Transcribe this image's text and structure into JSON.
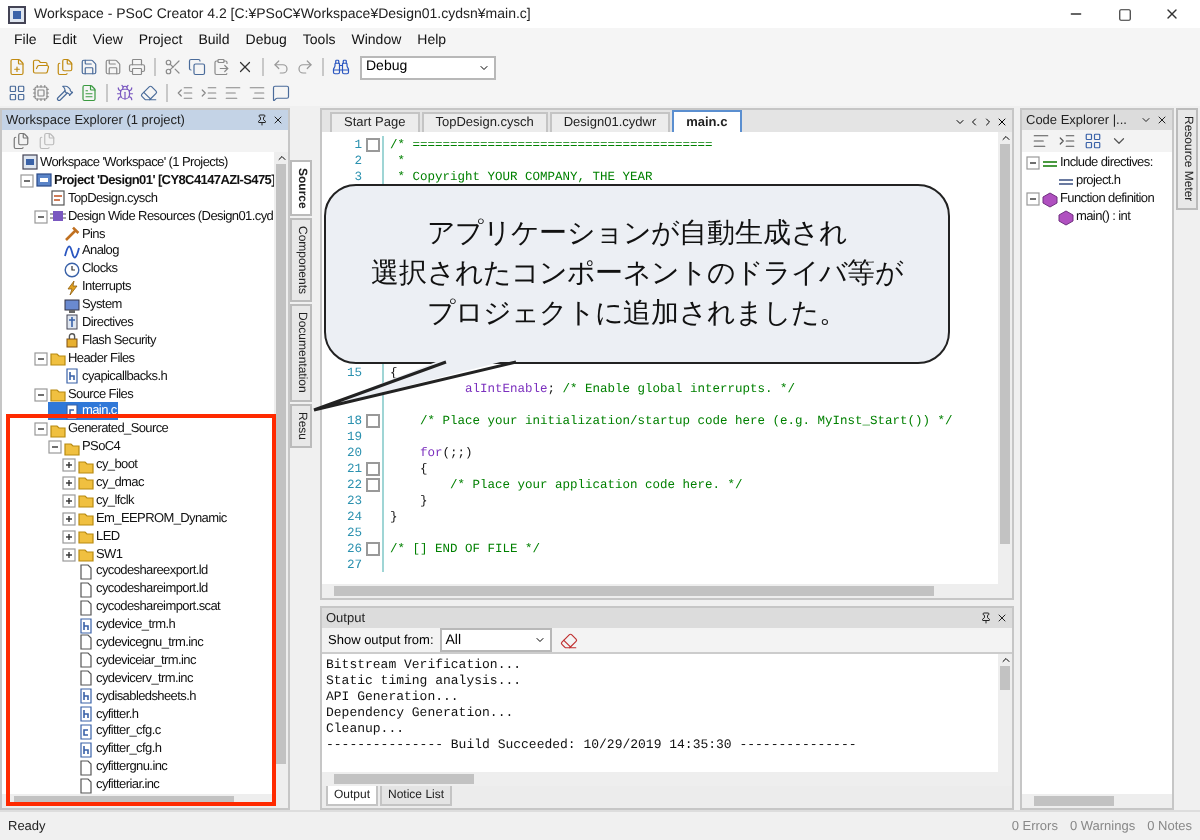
{
  "window": {
    "title": "Workspace - PSoC Creator 4.2  [C:¥PSoC¥Workspace¥Design01.cydsn¥main.c]"
  },
  "menu": [
    "File",
    "Edit",
    "View",
    "Project",
    "Build",
    "Debug",
    "Tools",
    "Window",
    "Help"
  ],
  "toolbar": {
    "configuration": "Debug"
  },
  "workspace_explorer": {
    "title": "Workspace Explorer (1 project)",
    "tree": [
      {
        "label": "Workspace 'Workspace' (1 Projects)",
        "kind": "workspace",
        "selected": false,
        "children": [
          {
            "label": "Project 'Design01' [CY8C4147AZI-S475]",
            "kind": "project",
            "bold": true,
            "expanded": true,
            "selected": false,
            "children": [
              {
                "label": "TopDesign.cysch",
                "kind": "schematic",
                "selected": false
              },
              {
                "label": "Design Wide Resources (Design01.cyd",
                "kind": "resources",
                "expanded": true,
                "selected": false,
                "children": [
                  {
                    "label": "Pins",
                    "kind": "pins",
                    "selected": false
                  },
                  {
                    "label": "Analog",
                    "kind": "analog",
                    "selected": false
                  },
                  {
                    "label": "Clocks",
                    "kind": "clocks",
                    "selected": false
                  },
                  {
                    "label": "Interrupts",
                    "kind": "interrupts",
                    "selected": false
                  },
                  {
                    "label": "System",
                    "kind": "system",
                    "selected": false
                  },
                  {
                    "label": "Directives",
                    "kind": "directives",
                    "selected": false
                  },
                  {
                    "label": "Flash Security",
                    "kind": "flash",
                    "selected": false
                  }
                ]
              },
              {
                "label": "Header Files",
                "kind": "folder",
                "expanded": true,
                "selected": false,
                "children": [
                  {
                    "label": "cyapicallbacks.h",
                    "kind": "header",
                    "selected": false
                  }
                ]
              },
              {
                "label": "Source Files",
                "kind": "folder",
                "expanded": true,
                "selected": false,
                "children": [
                  {
                    "label": "main.c",
                    "kind": "source",
                    "selected": true
                  }
                ]
              },
              {
                "label": "Generated_Source",
                "kind": "folder",
                "expanded": true,
                "selected": false,
                "children": [
                  {
                    "label": "PSoC4",
                    "kind": "folder",
                    "expanded": true,
                    "selected": false,
                    "children": [
                      {
                        "label": "cy_boot",
                        "kind": "folder",
                        "expanded": false,
                        "selected": false
                      },
                      {
                        "label": "cy_dmac",
                        "kind": "folder",
                        "expanded": false,
                        "selected": false
                      },
                      {
                        "label": "cy_lfclk",
                        "kind": "folder",
                        "expanded": false,
                        "selected": false
                      },
                      {
                        "label": "Em_EEPROM_Dynamic",
                        "kind": "folder",
                        "expanded": false,
                        "selected": false
                      },
                      {
                        "label": "LED",
                        "kind": "folder",
                        "expanded": false,
                        "selected": false
                      },
                      {
                        "label": "SW1",
                        "kind": "folder",
                        "expanded": false,
                        "selected": false
                      },
                      {
                        "label": "cycodeshareexport.ld",
                        "kind": "file",
                        "selected": false
                      },
                      {
                        "label": "cycodeshareimport.ld",
                        "kind": "file",
                        "selected": false
                      },
                      {
                        "label": "cycodeshareimport.scat",
                        "kind": "file",
                        "selected": false
                      },
                      {
                        "label": "cydevice_trm.h",
                        "kind": "header",
                        "selected": false
                      },
                      {
                        "label": "cydevicegnu_trm.inc",
                        "kind": "file",
                        "selected": false
                      },
                      {
                        "label": "cydeviceiar_trm.inc",
                        "kind": "file",
                        "selected": false
                      },
                      {
                        "label": "cydevicerv_trm.inc",
                        "kind": "file",
                        "selected": false
                      },
                      {
                        "label": "cydisabledsheets.h",
                        "kind": "header",
                        "selected": false
                      },
                      {
                        "label": "cyfitter.h",
                        "kind": "header",
                        "selected": false
                      },
                      {
                        "label": "cyfitter_cfg.c",
                        "kind": "source",
                        "selected": false
                      },
                      {
                        "label": "cyfitter_cfg.h",
                        "kind": "header",
                        "selected": false
                      },
                      {
                        "label": "cyfittergnu.inc",
                        "kind": "file",
                        "selected": false
                      },
                      {
                        "label": "cyfitteriar.inc",
                        "kind": "file",
                        "selected": false
                      }
                    ]
                  }
                ]
              }
            ]
          }
        ]
      }
    ],
    "side_tabs": [
      {
        "label": "Source",
        "selected": true
      },
      {
        "label": "Components",
        "selected": false
      },
      {
        "label": "Documentation",
        "selected": false
      },
      {
        "label": "Resu",
        "selected": false
      }
    ]
  },
  "editor": {
    "tabs": [
      {
        "label": "Start Page",
        "selected": false
      },
      {
        "label": "TopDesign.cysch",
        "selected": false
      },
      {
        "label": "Design01.cydwr",
        "selected": false
      },
      {
        "label": "main.c",
        "selected": true
      }
    ],
    "lines_top": [
      {
        "num": "1",
        "fold": true,
        "segments": [
          {
            "kind": "comment",
            "text": "/* ========================================"
          }
        ]
      },
      {
        "num": "2",
        "fold": false,
        "segments": [
          {
            "kind": "comment",
            "text": " *"
          }
        ]
      },
      {
        "num": "3",
        "fold": false,
        "segments": [
          {
            "kind": "comment",
            "text": " * Copyright YOUR COMPANY, THE YEAR"
          }
        ]
      }
    ],
    "lines_bottom": [
      {
        "num": "15",
        "fold": false,
        "segments": [
          {
            "kind": "plain",
            "text": "{"
          }
        ]
      },
      {
        "fold": false,
        "segments": [
          {
            "kind": "keyword",
            "text": "          alIntEnable"
          },
          {
            "kind": "plain",
            "text": ";"
          },
          {
            "kind": "comment",
            "text": " /* Enable global interrupts. */"
          }
        ]
      },
      {
        "fold": false
      },
      {
        "num": "18",
        "fold": true,
        "segments": [
          {
            "kind": "comment",
            "text": "    /* Place your initialization/startup code here (e.g. MyInst_Start()) */"
          }
        ]
      },
      {
        "num": "19",
        "fold": false
      },
      {
        "num": "20",
        "fold": false,
        "segments": [
          {
            "kind": "keyword",
            "text": "    for"
          },
          {
            "kind": "plain",
            "text": "(;;)"
          }
        ]
      },
      {
        "num": "21",
        "fold": true,
        "segments": [
          {
            "kind": "plain",
            "text": "    {"
          }
        ]
      },
      {
        "num": "22",
        "fold": true,
        "segments": [
          {
            "kind": "comment",
            "text": "        /* Place your application code here. */"
          }
        ]
      },
      {
        "num": "23",
        "fold": false,
        "segments": [
          {
            "kind": "plain",
            "text": "    }"
          }
        ]
      },
      {
        "num": "24",
        "fold": false,
        "segments": [
          {
            "kind": "plain",
            "text": "}"
          }
        ]
      },
      {
        "num": "25",
        "fold": false
      },
      {
        "num": "26",
        "fold": true,
        "segments": [
          {
            "kind": "comment",
            "text": "/* [] END OF FILE */"
          }
        ]
      },
      {
        "num": "27",
        "fold": false
      }
    ]
  },
  "output": {
    "title": "Output",
    "source_label": "Show output from:",
    "source": "All",
    "lines": [
      "Bitstream Verification...",
      "Static timing analysis...",
      "API Generation...",
      "Dependency Generation...",
      "Cleanup...",
      "--------------- Build Succeeded: 10/29/2019 14:35:30 ---------------"
    ],
    "tabs": [
      {
        "label": "Output",
        "selected": true
      },
      {
        "label": "Notice List",
        "selected": false
      }
    ]
  },
  "code_explorer": {
    "title": "Code Explorer |...",
    "tree": [
      {
        "label": "Include directives:",
        "kind": "include-group",
        "expanded": true,
        "selected": false,
        "children": [
          {
            "label": "project.h",
            "kind": "include",
            "selected": false
          }
        ]
      },
      {
        "label": "Function definition",
        "kind": "function-group",
        "expanded": true,
        "selected": false,
        "children": [
          {
            "label": "main() : int",
            "kind": "function",
            "selected": false
          }
        ]
      }
    ]
  },
  "resource_meter_tab": {
    "label": "Resource Meter"
  },
  "status_bar": {
    "text": "Ready",
    "errors": "0 Errors",
    "warnings": "0 Warnings",
    "notes": "0 Notes"
  },
  "callout": {
    "lines": [
      "アプリケーションが自動生成され",
      "選択されたコンポーネントのドライバ等が",
      "プロジェクトに追加されました。"
    ]
  }
}
